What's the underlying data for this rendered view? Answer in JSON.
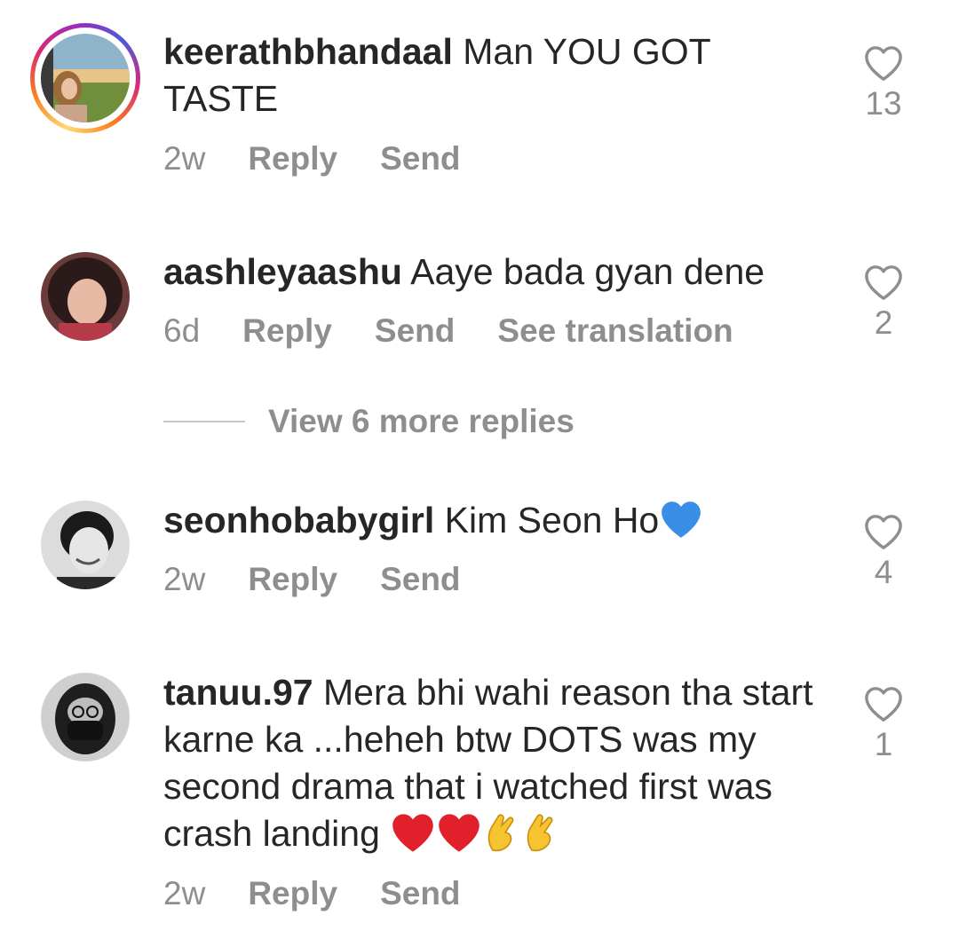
{
  "comments": [
    {
      "username": "keerathbhandaal",
      "text": "Man YOU GOT TASTE",
      "time": "2w",
      "actions": [
        "Reply",
        "Send"
      ],
      "likes": "13",
      "has_story": true,
      "avatar_icon": "avatar-photo"
    },
    {
      "username": "aashleyaashu",
      "text": "Aaye bada gyan dene",
      "time": "6d",
      "actions": [
        "Reply",
        "Send",
        "See translation"
      ],
      "likes": "2",
      "has_story": false,
      "avatar_icon": "avatar-photo"
    },
    {
      "username": "seonhobabygirl",
      "text": "Kim Seon Ho",
      "emoji": [
        "blue-heart-emoji"
      ],
      "time": "2w",
      "actions": [
        "Reply",
        "Send"
      ],
      "likes": "4",
      "has_story": false,
      "avatar_icon": "avatar-photo"
    },
    {
      "username": "tanuu.97",
      "text": "Mera bhi wahi reason tha start karne ka ...heheh btw DOTS was my second drama that i watched first was crash landing",
      "emoji": [
        "red-heart-emoji",
        "red-heart-emoji",
        "pinched-fingers-emoji",
        "pinched-fingers-emoji"
      ],
      "time": "2w",
      "actions": [
        "Reply",
        "Send"
      ],
      "likes": "1",
      "has_story": false,
      "avatar_icon": "avatar-photo"
    }
  ],
  "view_replies": "View 6 more replies",
  "colors": {
    "text": "#262626",
    "secondary": "#8e8e8e",
    "divider": "#c7c7c7",
    "blue_heart": "#3a8ee6",
    "red_heart": "#e0202b"
  }
}
